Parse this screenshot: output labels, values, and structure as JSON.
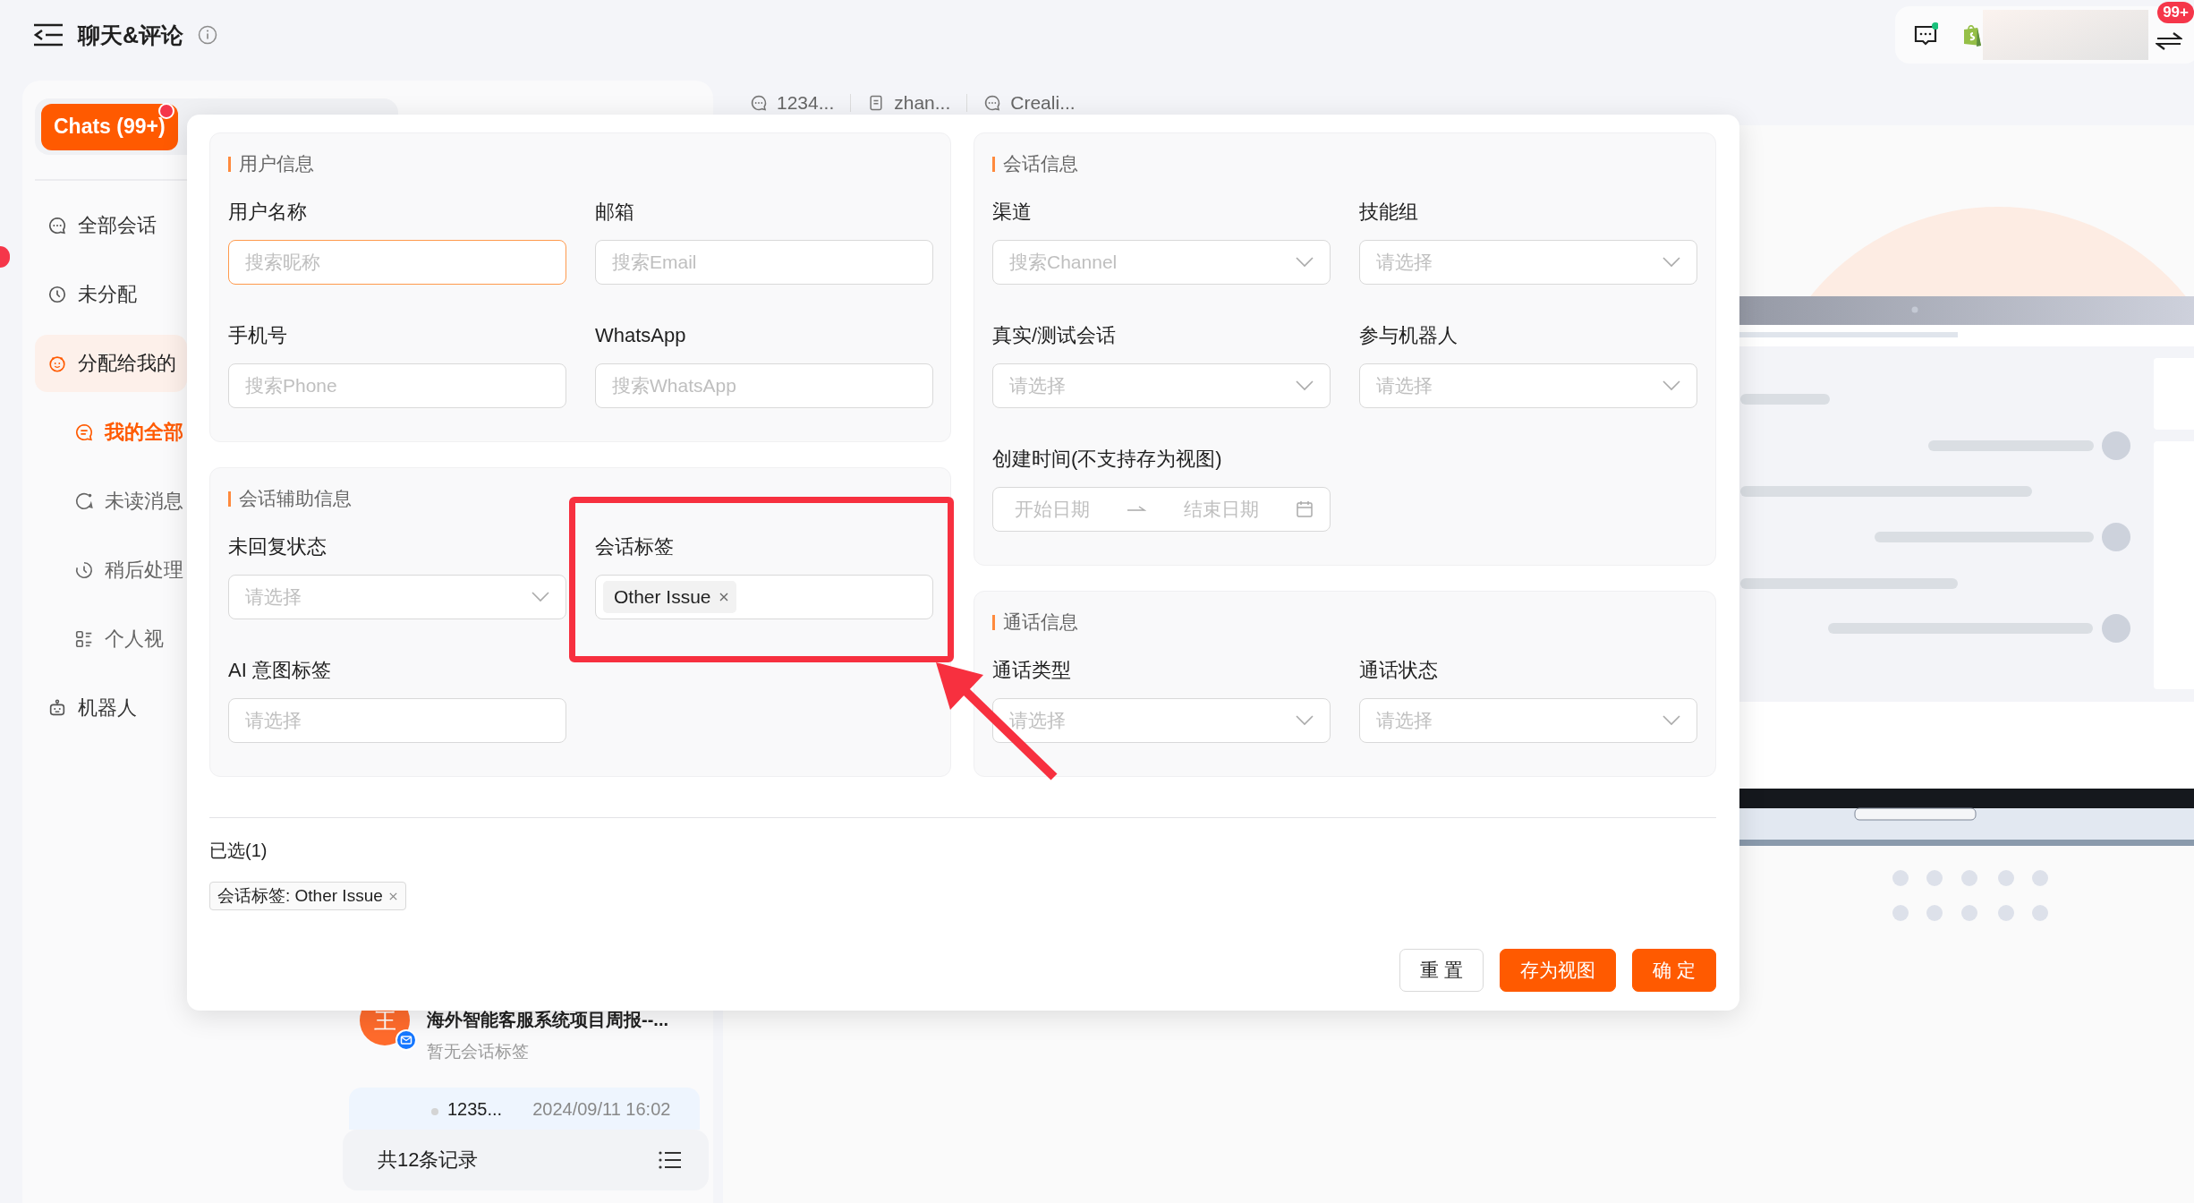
{
  "header": {
    "title": "聊天&评论"
  },
  "toolbar": {
    "badge": "99+"
  },
  "nav": {
    "segment": {
      "label": "Chats (99+)",
      "selected": true
    },
    "items": [
      {
        "label": "全部会话",
        "selected": false,
        "expanded": false
      },
      {
        "label": "未分配",
        "selected": false,
        "expanded": false
      },
      {
        "label": "分配给我的",
        "selected": false,
        "expanded": true,
        "children": [
          {
            "label": "我的全部",
            "selected": true
          },
          {
            "label": "未读消息",
            "selected": false
          },
          {
            "label": "稍后处理",
            "selected": false
          },
          {
            "label": "个人视",
            "selected": false
          }
        ]
      },
      {
        "label": "机器人",
        "selected": false,
        "expanded": false
      }
    ]
  },
  "tabs": [
    {
      "label": "1234..."
    },
    {
      "label": "zhan..."
    },
    {
      "label": "Creali..."
    }
  ],
  "list": {
    "items": [
      {
        "avatar": "王",
        "title": "海外智能客服系统项目周报--...",
        "subtitle": "暂无会话标签",
        "selected": false
      },
      {
        "title": "1235...",
        "time": "2024/09/11 16:02",
        "selected": true
      }
    ],
    "footer": "共12条记录"
  },
  "modal": {
    "columns": [
      {
        "sections": [
          {
            "title": "用户信息",
            "fields": [
              {
                "label": "用户名称",
                "kind": "input",
                "placeholder": "搜索昵称",
                "focused": true
              },
              {
                "label": "邮箱",
                "kind": "input",
                "placeholder": "搜索Email",
                "focused": false
              },
              {
                "label": "手机号",
                "kind": "input",
                "placeholder": "搜索Phone",
                "focused": false
              },
              {
                "label": "WhatsApp",
                "kind": "input",
                "placeholder": "搜索WhatsApp",
                "focused": false
              }
            ]
          },
          {
            "title": "会话辅助信息",
            "fields": [
              {
                "label": "未回复状态",
                "kind": "select",
                "placeholder": "请选择"
              },
              {
                "label": "会话标签",
                "kind": "tags",
                "tags": [
                  "Other Issue"
                ]
              },
              {
                "label": "AI 意图标签",
                "kind": "input",
                "placeholder": "请选择",
                "focused": false
              }
            ]
          }
        ]
      },
      {
        "sections": [
          {
            "title": "会话信息",
            "fields": [
              {
                "label": "渠道",
                "kind": "select",
                "placeholder": "搜索Channel"
              },
              {
                "label": "技能组",
                "kind": "select",
                "placeholder": "请选择"
              },
              {
                "label": "真实/测试会话",
                "kind": "select",
                "placeholder": "请选择"
              },
              {
                "label": "参与机器人",
                "kind": "select",
                "placeholder": "请选择"
              },
              {
                "label": "创建时间(不支持存为视图)",
                "kind": "daterange",
                "start_placeholder": "开始日期",
                "end_placeholder": "结束日期"
              }
            ]
          },
          {
            "title": "通话信息",
            "fields": [
              {
                "label": "通话类型",
                "kind": "select",
                "placeholder": "请选择"
              },
              {
                "label": "通话状态",
                "kind": "select",
                "placeholder": "请选择"
              }
            ]
          }
        ]
      }
    ],
    "summary": {
      "title": "已选(1)",
      "chips": [
        "会话标签: Other Issue"
      ]
    },
    "buttons": [
      {
        "label": "重 置",
        "kind": "default"
      },
      {
        "label": "存为视图",
        "kind": "primary"
      },
      {
        "label": "确 定",
        "kind": "primary"
      }
    ]
  }
}
